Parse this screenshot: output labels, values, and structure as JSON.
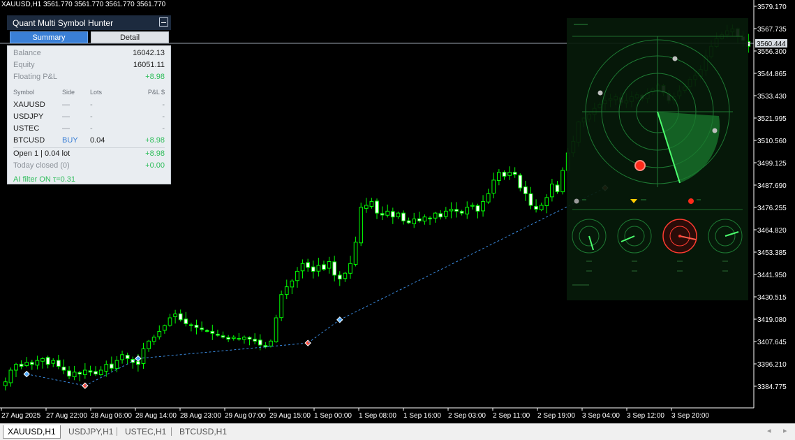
{
  "window": {
    "title": "XAUUSD,H1  3561.770 3561.770 3561.770 3561.770"
  },
  "panel": {
    "title": "Quant Multi Symbol Hunter",
    "tabs": {
      "summary": "Summary",
      "detail": "Detail"
    },
    "balance": {
      "label": "Balance",
      "value": "16042.13"
    },
    "equity": {
      "label": "Equity",
      "value": "16051.11"
    },
    "floating": {
      "label": "Floating P&L",
      "value": "+8.98"
    },
    "headers": {
      "symbol": "Symbol",
      "side": "Side",
      "lots": "Lots",
      "pl": "P&L $"
    },
    "rows": [
      {
        "symbol": "XAUUSD",
        "side": "—",
        "lots": "-",
        "pl": "-"
      },
      {
        "symbol": "USDJPY",
        "side": "—",
        "lots": "-",
        "pl": "-"
      },
      {
        "symbol": "USTEC",
        "side": "—",
        "lots": "-",
        "pl": "-"
      },
      {
        "symbol": "BTCUSD",
        "side": "BUY",
        "lots": "0.04",
        "pl": "+8.98"
      }
    ],
    "open": {
      "label": "Open 1 | 0.04 lot",
      "value": "+8.98"
    },
    "today_closed": {
      "label": "Today closed (0)",
      "value": "+0.00"
    },
    "ai_filter": "AI filter ON  τ=0.31"
  },
  "price_axis": {
    "labels": [
      "3579.170",
      "3567.735",
      "3556.300",
      "3544.865",
      "3533.430",
      "3521.995",
      "3510.560",
      "3499.125",
      "3487.690",
      "3476.255",
      "3464.820",
      "3453.385",
      "3441.950",
      "3430.515",
      "3419.080",
      "3407.645",
      "3396.210",
      "3384.775"
    ],
    "current_price": "3560.444"
  },
  "time_axis": {
    "labels": [
      "27 Aug 2025",
      "27 Aug 22:00",
      "28 Aug 06:00",
      "28 Aug 14:00",
      "28 Aug 23:00",
      "29 Aug 07:00",
      "29 Aug 15:00",
      "1 Sep 00:00",
      "1 Sep 08:00",
      "1 Sep 16:00",
      "2 Sep 03:00",
      "2 Sep 11:00",
      "2 Sep 19:00",
      "3 Sep 04:00",
      "3 Sep 12:00",
      "3 Sep 20:00"
    ]
  },
  "chart_data": {
    "type": "candlestick",
    "symbol": "XAUUSD",
    "timeframe": "H1",
    "ylim": [
      3376,
      3582
    ],
    "close": [
      3388,
      3394,
      3397,
      3396,
      3398,
      3397,
      3399,
      3400,
      3397,
      3399,
      3396,
      3394,
      3391,
      3393,
      3392,
      3394,
      3393,
      3392,
      3394,
      3397,
      3395,
      3399,
      3402,
      3400,
      3398,
      3397,
      3405,
      3409,
      3411,
      3414,
      3417,
      3421,
      3423,
      3420,
      3418,
      3417,
      3416,
      3415,
      3414,
      3413,
      3412,
      3411,
      3410,
      3411,
      3410,
      3411,
      3410,
      3409,
      3407,
      3406,
      3409,
      3421,
      3433,
      3437,
      3440,
      3445,
      3449,
      3447,
      3445,
      3448,
      3446,
      3450,
      3443,
      3441,
      3444,
      3449,
      3460,
      3478,
      3479,
      3481,
      3475,
      3474,
      3476,
      3473,
      3475,
      3471,
      3470,
      3472,
      3471,
      3473,
      3472,
      3475,
      3473,
      3476,
      3477,
      3476,
      3475,
      3478,
      3479,
      3476,
      3481,
      3485,
      3492,
      3496,
      3494,
      3496,
      3495,
      3488,
      3485,
      3479,
      3477,
      3479,
      3483,
      3490,
      3486,
      3497,
      3506,
      3512,
      3522,
      3524,
      3526,
      3529,
      3531,
      3533,
      3534,
      3535,
      3532,
      3533,
      3535,
      3536,
      3534,
      3537,
      3539,
      3541,
      3537,
      3533,
      3535,
      3538,
      3540,
      3544,
      3546,
      3549,
      3556,
      3561,
      3565,
      3567,
      3569,
      3570,
      3566,
      3564,
      3561
    ],
    "markers": [
      {
        "type": "buy",
        "price": 3392
      },
      {
        "type": "sell",
        "price": 3386
      },
      {
        "type": "buy",
        "price": 3400
      },
      {
        "type": "sell",
        "price": 3408
      },
      {
        "type": "buy",
        "price": 3420
      },
      {
        "type": "sell",
        "price": 3488
      }
    ]
  },
  "symbol_tabs": [
    "XAUUSD,H1",
    "USDJPY,H1",
    "USTEC,H1",
    "BTCUSD,H1"
  ],
  "colors": {
    "bull": "#00ff00",
    "grid": "#1a1a1a",
    "text": "#ffffff",
    "radar": "#1fae3c",
    "alert": "#ff3b30",
    "trendline": "#3a8be0"
  }
}
